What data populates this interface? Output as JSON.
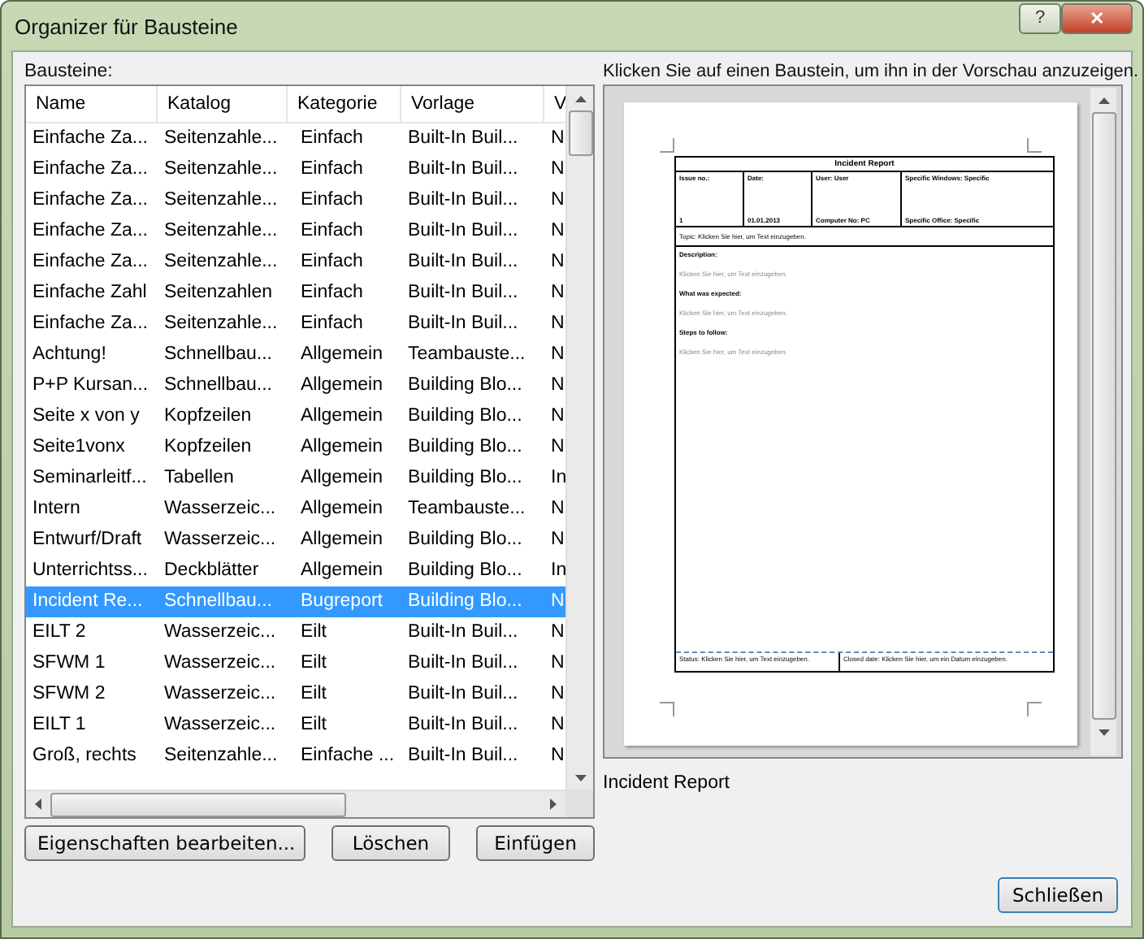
{
  "window": {
    "title": "Organizer für Bausteine",
    "help_button": "?",
    "close_button": "✕"
  },
  "list_label": "Bausteine:",
  "table": {
    "columns": [
      "Name",
      "Katalog",
      "Kategorie",
      "Vorlage",
      "V"
    ],
    "rows": [
      {
        "cells": [
          "Einfache Za...",
          "Seitenzahle...",
          "Einfach",
          "Built-In Buil...",
          "N"
        ],
        "selected": false
      },
      {
        "cells": [
          "Einfache Za...",
          "Seitenzahle...",
          "Einfach",
          "Built-In Buil...",
          "N"
        ],
        "selected": false
      },
      {
        "cells": [
          "Einfache Za...",
          "Seitenzahle...",
          "Einfach",
          "Built-In Buil...",
          "N"
        ],
        "selected": false
      },
      {
        "cells": [
          "Einfache Za...",
          "Seitenzahle...",
          "Einfach",
          "Built-In Buil...",
          "N"
        ],
        "selected": false
      },
      {
        "cells": [
          "Einfache Za...",
          "Seitenzahle...",
          "Einfach",
          "Built-In Buil...",
          "N"
        ],
        "selected": false
      },
      {
        "cells": [
          "Einfache Zahl",
          "Seitenzahlen",
          "Einfach",
          "Built-In Buil...",
          "N"
        ],
        "selected": false
      },
      {
        "cells": [
          "Einfache Za...",
          "Seitenzahle...",
          "Einfach",
          "Built-In Buil...",
          "N"
        ],
        "selected": false
      },
      {
        "cells": [
          "Achtung!",
          "Schnellbau...",
          "Allgemein",
          "Teambauste...",
          "N"
        ],
        "selected": false
      },
      {
        "cells": [
          "P+P Kursan...",
          "Schnellbau...",
          "Allgemein",
          "Building Blo...",
          "N"
        ],
        "selected": false
      },
      {
        "cells": [
          "Seite x von y",
          "Kopfzeilen",
          "Allgemein",
          "Building Blo...",
          "N"
        ],
        "selected": false
      },
      {
        "cells": [
          "Seite1vonx",
          "Kopfzeilen",
          "Allgemein",
          "Building Blo...",
          "N"
        ],
        "selected": false
      },
      {
        "cells": [
          "Seminarleitf...",
          "Tabellen",
          "Allgemein",
          "Building Blo...",
          "In"
        ],
        "selected": false
      },
      {
        "cells": [
          "Intern",
          "Wasserzeic...",
          "Allgemein",
          "Teambauste...",
          "N"
        ],
        "selected": false
      },
      {
        "cells": [
          "Entwurf/Draft",
          "Wasserzeic...",
          "Allgemein",
          "Building Blo...",
          "N"
        ],
        "selected": false
      },
      {
        "cells": [
          "Unterrichtss...",
          "Deckblätter",
          "Allgemein",
          "Building Blo...",
          "In"
        ],
        "selected": false
      },
      {
        "cells": [
          "Incident Re...",
          "Schnellbau...",
          "Bugreport",
          "Building Blo...",
          "N"
        ],
        "selected": true
      },
      {
        "cells": [
          "EILT 2",
          "Wasserzeic...",
          "Eilt",
          "Built-In Buil...",
          "N"
        ],
        "selected": false
      },
      {
        "cells": [
          "SFWM 1",
          "Wasserzeic...",
          "Eilt",
          "Built-In Buil...",
          "N"
        ],
        "selected": false
      },
      {
        "cells": [
          "SFWM 2",
          "Wasserzeic...",
          "Eilt",
          "Built-In Buil...",
          "N"
        ],
        "selected": false
      },
      {
        "cells": [
          "EILT 1",
          "Wasserzeic...",
          "Eilt",
          "Built-In Buil...",
          "N"
        ],
        "selected": false
      },
      {
        "cells": [
          "Groß, rechts",
          "Seitenzahle...",
          "Einfache ...",
          "Built-In Buil...",
          "N"
        ],
        "selected": false
      }
    ]
  },
  "buttons": [
    "Eigenschaften bearbeiten...",
    "Löschen",
    "Einfügen"
  ],
  "preview": {
    "hint": "Klicken Sie auf einen Baustein, um ihn in der Vorschau anzuzeigen.",
    "document": {
      "title": "Incident Report",
      "header_cells": [
        [
          "Issue no.:",
          "1"
        ],
        [
          "Date:",
          "01.01.2013"
        ],
        [
          "User: User",
          "Computer No: PC"
        ],
        [
          "Specific Windows: Specific",
          "Specific Office: Specific"
        ]
      ],
      "topic": "Topic: Klicken Sie hier, um Text einzugeben.",
      "sections": [
        {
          "heading": "Description:",
          "text": "Klicken Sie hier, um Text einzugeben."
        },
        {
          "heading": "What was expected:",
          "text": "Klicken Sie hier, um Text einzugeben."
        },
        {
          "heading": "Steps to follow:",
          "text": "Klicken Sie hier, um Text einzugeben."
        }
      ],
      "footer_cells": [
        "Status: Klicken Sie hier, um Text einzugeben.",
        "Closed date: Klicken Sie hier, um ein Datum einzugeben."
      ]
    },
    "caption": "Incident Report"
  },
  "close": "Schließen"
}
